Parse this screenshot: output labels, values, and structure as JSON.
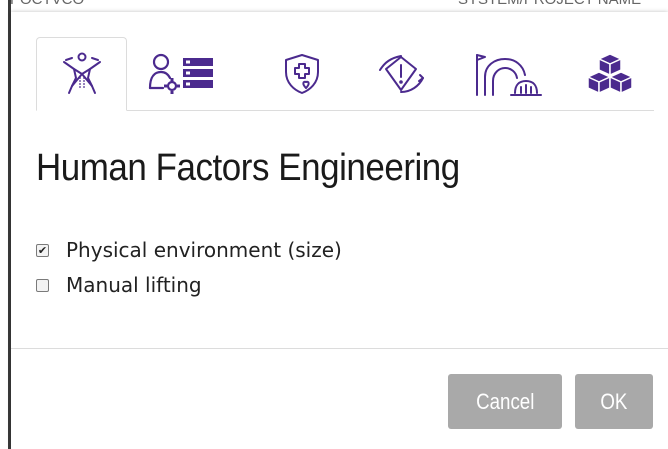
{
  "background": {
    "fragment_left": "POCTVCO",
    "fragment_right": "SYSTEM/PROJECT NAME"
  },
  "dialog": {
    "title": "Human Factors Engineering",
    "tabs": [
      {
        "icon": "human-factors-icon",
        "active": true
      },
      {
        "icon": "personnel-settings-icon",
        "active": false
      },
      {
        "icon": "health-shield-icon",
        "active": false
      },
      {
        "icon": "safety-shield-icon",
        "active": false
      },
      {
        "icon": "environment-arch-icon",
        "active": false
      },
      {
        "icon": "cubes-icon",
        "active": false
      }
    ],
    "options": [
      {
        "label": "Physical environment (size)",
        "checked": true
      },
      {
        "label": "Manual lifting",
        "checked": false
      }
    ],
    "buttons": {
      "cancel": "Cancel",
      "ok": "OK"
    }
  },
  "colors": {
    "icon_purple": "#4b2a8e",
    "button_gray": "#a9a9a9"
  }
}
